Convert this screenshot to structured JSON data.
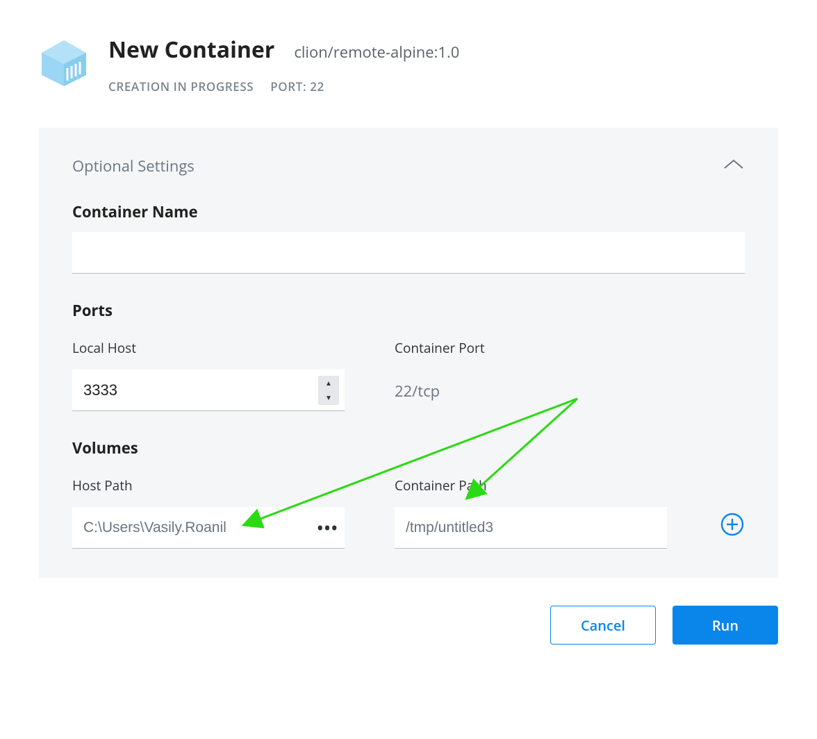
{
  "header": {
    "title": "New Container",
    "image": "clion/remote-alpine:1.0",
    "status": "CREATION IN PROGRESS",
    "port_label": "PORT: 22"
  },
  "panel": {
    "title": "Optional Settings"
  },
  "container_name": {
    "heading": "Container Name",
    "value": ""
  },
  "ports": {
    "heading": "Ports",
    "local_host_label": "Local Host",
    "local_host_value": "3333",
    "container_port_label": "Container Port",
    "container_port_value": "22/tcp"
  },
  "volumes": {
    "heading": "Volumes",
    "host_path_label": "Host Path",
    "host_path_value": "C:\\Users\\Vasily.Roanil",
    "container_path_label": "Container Path",
    "container_path_value": "/tmp/untitled3"
  },
  "buttons": {
    "cancel": "Cancel",
    "run": "Run"
  },
  "colors": {
    "accent": "#0a85ea",
    "panel_bg": "#f5f6f7",
    "annotation": "#2ada13"
  }
}
